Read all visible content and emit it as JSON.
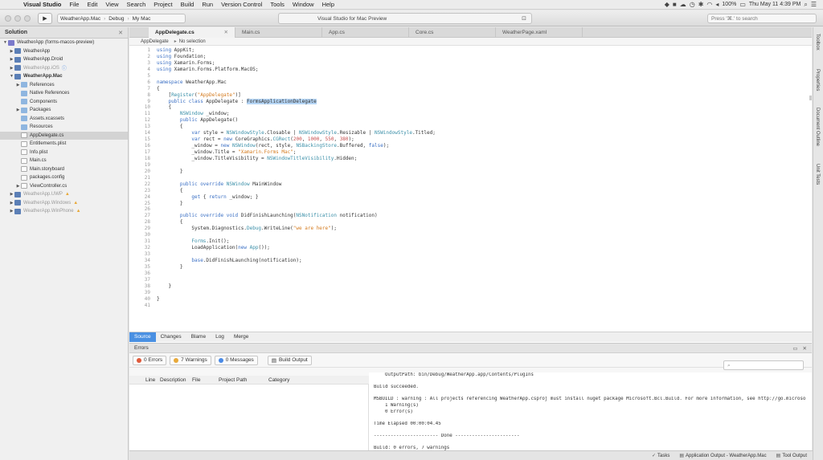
{
  "menubar": {
    "app": "Visual Studio",
    "items": [
      "File",
      "Edit",
      "View",
      "Search",
      "Project",
      "Build",
      "Run",
      "Version Control",
      "Tools",
      "Window",
      "Help"
    ],
    "battery": "100%",
    "clock": "Thu May 11  4:39 PM"
  },
  "toolbar": {
    "project": "WeatherApp.Mac",
    "config": "Debug",
    "device": "My Mac",
    "status": "Visual Studio for Mac Preview",
    "search_placeholder": "Press '⌘.' to search"
  },
  "solution": {
    "title": "Solution",
    "items": [
      {
        "label": "WeatherApp (forms-macos-preview)",
        "indent": 0,
        "arrow": "▼",
        "icon": "sln"
      },
      {
        "label": "WeatherApp",
        "indent": 1,
        "arrow": "▶",
        "icon": "proj"
      },
      {
        "label": "WeatherApp.Droid",
        "indent": 1,
        "arrow": "▶",
        "icon": "proj"
      },
      {
        "label": "WeatherApp.iOS",
        "indent": 1,
        "arrow": "▶",
        "icon": "proj",
        "dim": true,
        "badge": "info"
      },
      {
        "label": "WeatherApp.Mac",
        "indent": 1,
        "arrow": "▼",
        "icon": "proj",
        "bold": true
      },
      {
        "label": "References",
        "indent": 2,
        "arrow": "▶",
        "icon": "folder"
      },
      {
        "label": "Native References",
        "indent": 2,
        "arrow": "",
        "icon": "folder"
      },
      {
        "label": "Components",
        "indent": 2,
        "arrow": "",
        "icon": "folder"
      },
      {
        "label": "Packages",
        "indent": 2,
        "arrow": "▶",
        "icon": "folder"
      },
      {
        "label": "Assets.xcassets",
        "indent": 2,
        "arrow": "",
        "icon": "folder"
      },
      {
        "label": "Resources",
        "indent": 2,
        "arrow": "",
        "icon": "folder"
      },
      {
        "label": "AppDelegate.cs",
        "indent": 2,
        "arrow": "",
        "icon": "file",
        "selected": true
      },
      {
        "label": "Entitlements.plist",
        "indent": 2,
        "arrow": "",
        "icon": "file"
      },
      {
        "label": "Info.plist",
        "indent": 2,
        "arrow": "",
        "icon": "file"
      },
      {
        "label": "Main.cs",
        "indent": 2,
        "arrow": "",
        "icon": "file"
      },
      {
        "label": "Main.storyboard",
        "indent": 2,
        "arrow": "",
        "icon": "file"
      },
      {
        "label": "packages.config",
        "indent": 2,
        "arrow": "",
        "icon": "file"
      },
      {
        "label": "ViewController.cs",
        "indent": 2,
        "arrow": "▶",
        "icon": "file"
      },
      {
        "label": "WeatherApp.UWP",
        "indent": 1,
        "arrow": "▶",
        "icon": "proj",
        "dim": true,
        "badge": "warn"
      },
      {
        "label": "WeatherApp.Windows",
        "indent": 1,
        "arrow": "▶",
        "icon": "proj",
        "dim": true,
        "badge": "warn"
      },
      {
        "label": "WeatherApp.WinPhone",
        "indent": 1,
        "arrow": "▶",
        "icon": "proj",
        "dim": true,
        "badge": "warn"
      }
    ]
  },
  "editor": {
    "tabs": [
      "AppDelegate.cs",
      "Main.cs",
      "App.cs",
      "Core.cs",
      "WeatherPage.xaml"
    ],
    "active_tab": 0,
    "path": [
      "AppDelegate",
      "No selection"
    ],
    "lines": [
      [
        [
          "kw",
          "using"
        ],
        [
          "t",
          " AppKit;"
        ]
      ],
      [
        [
          "kw",
          "using"
        ],
        [
          "t",
          " Foundation;"
        ]
      ],
      [
        [
          "kw",
          "using"
        ],
        [
          "t",
          " Xamarin.Forms;"
        ]
      ],
      [
        [
          "kw",
          "using"
        ],
        [
          "t",
          " Xamarin.Forms.Platform.MacOS;"
        ]
      ],
      [],
      [
        [
          "kw",
          "namespace"
        ],
        [
          "t",
          " WeatherApp.Mac"
        ]
      ],
      [
        [
          "t",
          "{"
        ]
      ],
      [
        [
          "t",
          "    ["
        ],
        [
          "typ",
          "Register"
        ],
        [
          "t",
          "("
        ],
        [
          "str",
          "\"AppDelegate\""
        ],
        [
          "t",
          ")]"
        ]
      ],
      [
        [
          "t",
          "    "
        ],
        [
          "kw",
          "public class"
        ],
        [
          "t",
          " AppDelegate : "
        ],
        [
          "hl",
          "FormsApplicationDelegate"
        ]
      ],
      [
        [
          "t",
          "    {"
        ]
      ],
      [
        [
          "t",
          "        "
        ],
        [
          "typ",
          "NSWindow"
        ],
        [
          "t",
          " _window;"
        ]
      ],
      [
        [
          "t",
          "        "
        ],
        [
          "kw",
          "public"
        ],
        [
          "t",
          " AppDelegate()"
        ]
      ],
      [
        [
          "t",
          "        {"
        ]
      ],
      [
        [
          "t",
          "            "
        ],
        [
          "kw",
          "var"
        ],
        [
          "t",
          " style = "
        ],
        [
          "typ",
          "NSWindowStyle"
        ],
        [
          "t",
          ".Closable | "
        ],
        [
          "typ",
          "NSWindowStyle"
        ],
        [
          "t",
          ".Resizable | "
        ],
        [
          "typ",
          "NSWindowStyle"
        ],
        [
          "t",
          ".Titled;"
        ]
      ],
      [
        [
          "t",
          "            "
        ],
        [
          "kw",
          "var"
        ],
        [
          "t",
          " rect = "
        ],
        [
          "kw",
          "new"
        ],
        [
          "t",
          " CoreGraphics."
        ],
        [
          "typ",
          "CGRect"
        ],
        [
          "t",
          "("
        ],
        [
          "num",
          "200"
        ],
        [
          "t",
          ", "
        ],
        [
          "num",
          "1000"
        ],
        [
          "t",
          ", "
        ],
        [
          "num",
          "550"
        ],
        [
          "t",
          ", "
        ],
        [
          "num",
          "380"
        ],
        [
          "t",
          ");"
        ]
      ],
      [
        [
          "t",
          "            _window = "
        ],
        [
          "kw",
          "new"
        ],
        [
          "t",
          " "
        ],
        [
          "typ",
          "NSWindow"
        ],
        [
          "t",
          "(rect, style, "
        ],
        [
          "typ",
          "NSBackingStore"
        ],
        [
          "t",
          ".Buffered, "
        ],
        [
          "kw",
          "false"
        ],
        [
          "t",
          ");"
        ]
      ],
      [
        [
          "t",
          "            _window.Title = "
        ],
        [
          "str",
          "\"Xamarin.Forms Mac\""
        ],
        [
          "t",
          ";"
        ]
      ],
      [
        [
          "t",
          "            _window.TitleVisibility = "
        ],
        [
          "typ",
          "NSWindowTitleVisibility"
        ],
        [
          "t",
          ".Hidden;"
        ]
      ],
      [],
      [
        [
          "t",
          "        }"
        ]
      ],
      [],
      [
        [
          "t",
          "        "
        ],
        [
          "kw",
          "public override"
        ],
        [
          "t",
          " "
        ],
        [
          "typ",
          "NSWindow"
        ],
        [
          "t",
          " MainWindow"
        ]
      ],
      [
        [
          "t",
          "        {"
        ]
      ],
      [
        [
          "t",
          "            "
        ],
        [
          "kw",
          "get"
        ],
        [
          "t",
          " { "
        ],
        [
          "kw",
          "return"
        ],
        [
          "t",
          " _window; }"
        ]
      ],
      [
        [
          "t",
          "        }"
        ]
      ],
      [],
      [
        [
          "t",
          "        "
        ],
        [
          "kw",
          "public override void"
        ],
        [
          "t",
          " DidFinishLaunching("
        ],
        [
          "typ",
          "NSNotification"
        ],
        [
          "t",
          " notification)"
        ]
      ],
      [
        [
          "t",
          "        {"
        ]
      ],
      [
        [
          "t",
          "            System.Diagnostics."
        ],
        [
          "typ",
          "Debug"
        ],
        [
          "t",
          ".WriteLine("
        ],
        [
          "str",
          "\"we are here\""
        ],
        [
          "t",
          ");"
        ]
      ],
      [],
      [
        [
          "t",
          "            "
        ],
        [
          "typ",
          "Forms"
        ],
        [
          "t",
          ".Init();"
        ]
      ],
      [
        [
          "t",
          "            LoadApplication("
        ],
        [
          "kw",
          "new"
        ],
        [
          "t",
          " "
        ],
        [
          "typ",
          "App"
        ],
        [
          "t",
          "());"
        ]
      ],
      [],
      [
        [
          "t",
          "            "
        ],
        [
          "kw",
          "base"
        ],
        [
          "t",
          ".DidFinishLaunching(notification);"
        ]
      ],
      [
        [
          "t",
          "        }"
        ]
      ],
      [],
      [],
      [
        [
          "t",
          "    }"
        ]
      ],
      [],
      [
        [
          "t",
          "}"
        ]
      ],
      []
    ]
  },
  "source_tabs": [
    "Source",
    "Changes",
    "Blame",
    "Log",
    "Merge"
  ],
  "errors_pad": {
    "title": "Errors",
    "errors_label": "0 Errors",
    "warnings_label": "7 Warnings",
    "messages_label": "0 Messages",
    "build_output_label": "Build Output",
    "columns": [
      "!",
      "Line",
      "Description",
      "File",
      "Project",
      "Path",
      "Category"
    ]
  },
  "output": [
    "    OutputPath: bin/Debug/WeatherApp.app/Contents/PlugIns",
    "",
    "Build succeeded.",
    "",
    "MSBUILD : warning : All projects referencing WeatherApp.csproj must install nuget package Microsoft.Bcl.Build. For more information, see http://go.microso",
    "    1 Warning(s)",
    "    0 Error(s)",
    "",
    "Time Elapsed 00:00:04.45",
    "",
    "----------------------- Done -----------------------",
    "",
    "Build: 0 errors, 7 warnings"
  ],
  "rightdock": [
    "Toolbox",
    "Properties",
    "Document Outline",
    "Unit Tests"
  ],
  "statusbar": {
    "tasks": "Tasks",
    "app_output": "Application Output - WeatherApp.Mac",
    "tool_output": "Tool Output"
  }
}
